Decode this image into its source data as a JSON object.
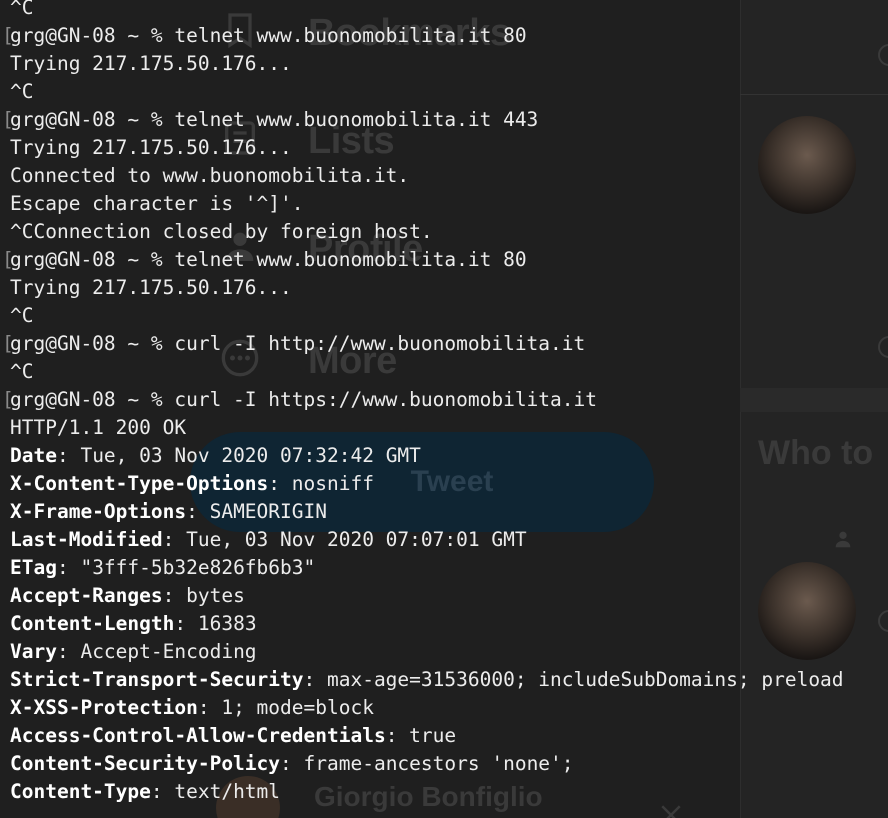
{
  "background": {
    "nav_items": [
      {
        "label": "Bookmarks",
        "icon": "bookmark-icon"
      },
      {
        "label": "Lists",
        "icon": "list-icon"
      },
      {
        "label": "Profile",
        "icon": "person-icon"
      },
      {
        "label": "More",
        "icon": "more-icon"
      }
    ],
    "tweet_button_label": "Tweet",
    "who_to_follow_label": "Who to",
    "footer_name": "Giorgio Bonfiglio"
  },
  "terminal": {
    "lines": [
      {
        "prompt": "",
        "text": "^C"
      },
      {
        "prompt": "[",
        "text": "grg@GN-08 ~ % telnet www.buonomobilita.it 80"
      },
      {
        "prompt": "",
        "text": "Trying 217.175.50.176..."
      },
      {
        "prompt": "",
        "text": "^C"
      },
      {
        "prompt": "[",
        "text": "grg@GN-08 ~ % telnet www.buonomobilita.it 443"
      },
      {
        "prompt": "",
        "text": "Trying 217.175.50.176..."
      },
      {
        "prompt": "",
        "text": "Connected to www.buonomobilita.it."
      },
      {
        "prompt": "",
        "text": "Escape character is '^]'."
      },
      {
        "prompt": "",
        "text": "^CConnection closed by foreign host."
      },
      {
        "prompt": "[",
        "text": "grg@GN-08 ~ % telnet www.buonomobilita.it 80"
      },
      {
        "prompt": "",
        "text": "Trying 217.175.50.176..."
      },
      {
        "prompt": "",
        "text": "^C"
      },
      {
        "prompt": "[",
        "text": "grg@GN-08 ~ % curl -I http://www.buonomobilita.it"
      },
      {
        "prompt": "",
        "text": "^C"
      },
      {
        "prompt": "[",
        "text": "grg@GN-08 ~ % curl -I https://www.buonomobilita.it"
      },
      {
        "prompt": "",
        "text": "HTTP/1.1 200 OK"
      }
    ],
    "headers": [
      {
        "key": "Date",
        "value": ": Tue, 03 Nov 2020 07:32:42 GMT"
      },
      {
        "key": "X-Content-Type-Options",
        "value": ": nosniff"
      },
      {
        "key": "X-Frame-Options",
        "value": ": SAMEORIGIN"
      },
      {
        "key": "Last-Modified",
        "value": ": Tue, 03 Nov 2020 07:07:01 GMT"
      },
      {
        "key": "ETag",
        "value": ": \"3fff-5b32e826fb6b3\""
      },
      {
        "key": "Accept-Ranges",
        "value": ": bytes"
      },
      {
        "key": "Content-Length",
        "value": ": 16383"
      },
      {
        "key": "Vary",
        "value": ": Accept-Encoding"
      },
      {
        "key": "Strict-Transport-Security",
        "value": ": max-age=31536000; includeSubDomains; preload"
      },
      {
        "key": "X-XSS-Protection",
        "value": ": 1; mode=block"
      },
      {
        "key": "Access-Control-Allow-Credentials",
        "value": ": true"
      },
      {
        "key": "Content-Security-Policy",
        "value": ": frame-ancestors 'none';"
      },
      {
        "key": "Content-Type",
        "value": ": text/html"
      }
    ]
  }
}
